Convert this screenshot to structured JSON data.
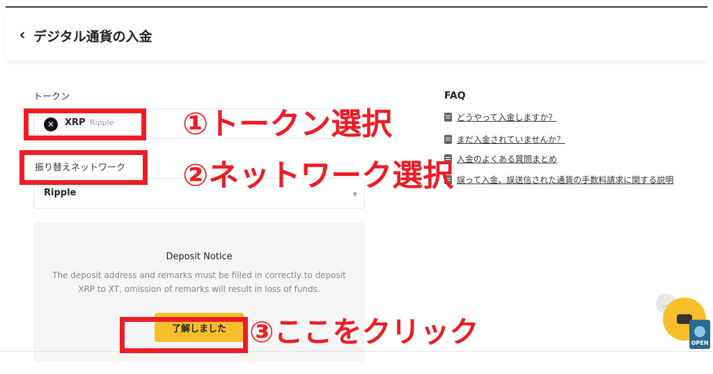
{
  "header": {
    "back_icon": "chevron-left-icon",
    "title": "デジタル通貨の入金"
  },
  "token": {
    "label": "トークン",
    "symbol": "XRP",
    "name": "Ripple",
    "icon": "xrp-icon",
    "dropdown_icon": "caret-down-icon"
  },
  "network": {
    "label": "振り替えネットワーク",
    "value": "Ripple",
    "dropdown_icon": "caret-down-icon"
  },
  "notice": {
    "title": "Deposit Notice",
    "text": "The deposit address and remarks must be filled in correctly to deposit XRP to XT, omission of remarks will result in loss of funds.",
    "button": "了解しました"
  },
  "faq": {
    "title": "FAQ",
    "items": [
      "どうやって入金しますか？",
      "まだ入金されていませんか？",
      "入金のよくある質問まとめ",
      "誤って入金、誤送信された通貨の手数料請求に関する説明"
    ]
  },
  "widgets": {
    "scroll_top_icon": "chevron-up-icon",
    "chat_icon": "chat-icon",
    "open_label": "OPEN"
  },
  "annotations": {
    "step1": "①トークン選択",
    "step2": "②ネットワーク選択",
    "step3": "③ここをクリック",
    "color": "#ee1c25"
  },
  "colors": {
    "accent": "#f8bf2a",
    "annotation": "#ee1c25"
  }
}
